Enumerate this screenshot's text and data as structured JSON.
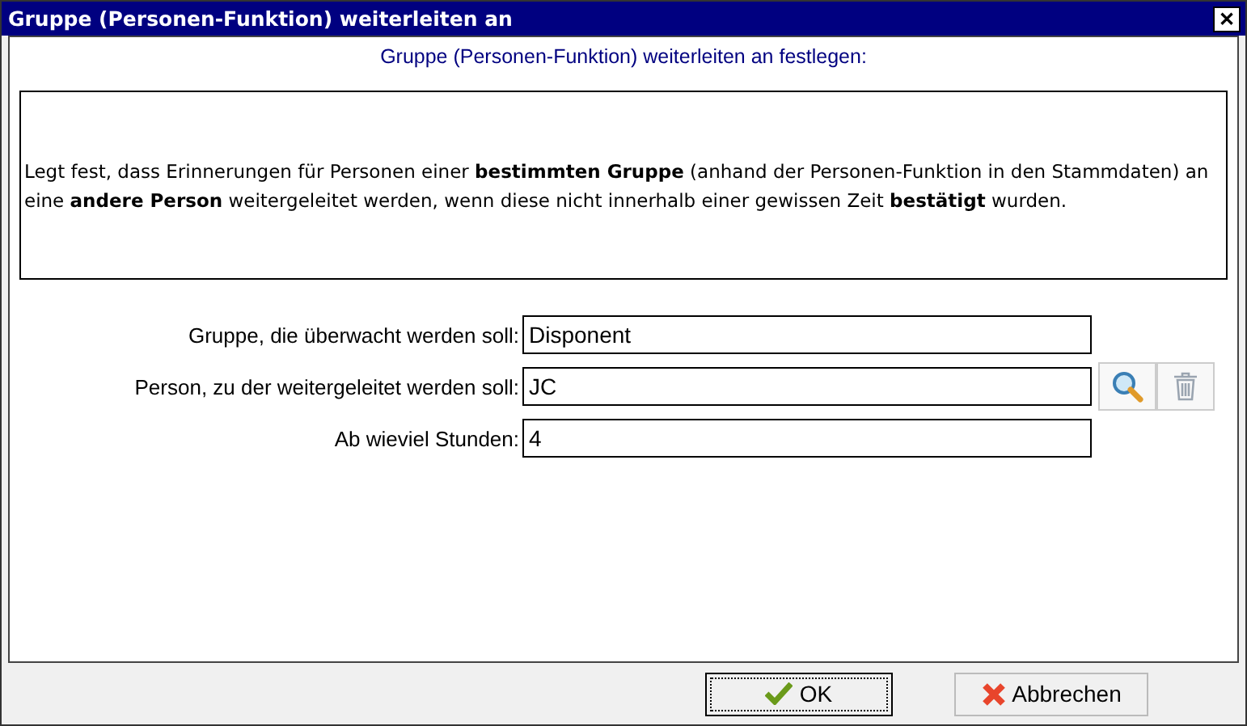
{
  "window": {
    "title": "Gruppe (Personen-Funktion) weiterleiten an",
    "close": "✕"
  },
  "heading": "Gruppe (Personen-Funktion) weiterleiten an festlegen:",
  "description": "Legt fest, dass Erinnerungen für Personen einer **bestimmten Gruppe** (anhand der Personen-Funktion in den Stammdaten) an eine **andere Person** weitergeleitet werden, wenn diese nicht innerhalb einer gewissen Zeit **bestätigt** wurden.",
  "fields": [
    {
      "kind": "plain",
      "label": "Gruppe, die überwacht werden soll:",
      "value": "Disponent"
    },
    {
      "kind": "lookup",
      "label": "Person, zu der weitergeleitet werden soll:",
      "value": "JC"
    },
    {
      "kind": "plain",
      "label": "Ab wieviel Stunden:",
      "value": "4"
    }
  ],
  "buttons": [
    {
      "kind": "ok",
      "label": "OK",
      "focused": true
    },
    {
      "kind": "cancel",
      "label": "Abbrechen",
      "focused": false
    }
  ]
}
